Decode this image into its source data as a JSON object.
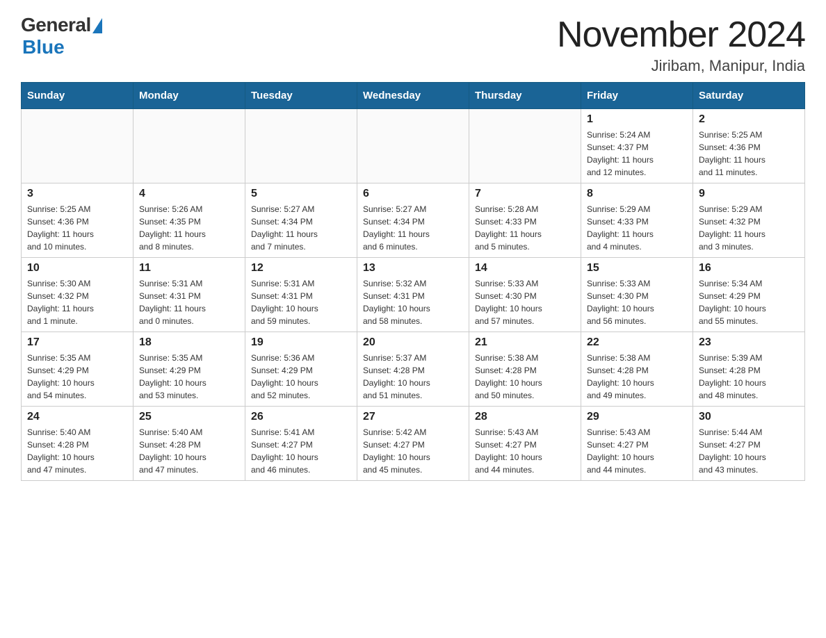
{
  "header": {
    "logo_general": "General",
    "logo_blue": "Blue",
    "month_title": "November 2024",
    "location": "Jiribam, Manipur, India"
  },
  "weekdays": [
    "Sunday",
    "Monday",
    "Tuesday",
    "Wednesday",
    "Thursday",
    "Friday",
    "Saturday"
  ],
  "weeks": [
    [
      {
        "day": "",
        "info": ""
      },
      {
        "day": "",
        "info": ""
      },
      {
        "day": "",
        "info": ""
      },
      {
        "day": "",
        "info": ""
      },
      {
        "day": "",
        "info": ""
      },
      {
        "day": "1",
        "info": "Sunrise: 5:24 AM\nSunset: 4:37 PM\nDaylight: 11 hours\nand 12 minutes."
      },
      {
        "day": "2",
        "info": "Sunrise: 5:25 AM\nSunset: 4:36 PM\nDaylight: 11 hours\nand 11 minutes."
      }
    ],
    [
      {
        "day": "3",
        "info": "Sunrise: 5:25 AM\nSunset: 4:36 PM\nDaylight: 11 hours\nand 10 minutes."
      },
      {
        "day": "4",
        "info": "Sunrise: 5:26 AM\nSunset: 4:35 PM\nDaylight: 11 hours\nand 8 minutes."
      },
      {
        "day": "5",
        "info": "Sunrise: 5:27 AM\nSunset: 4:34 PM\nDaylight: 11 hours\nand 7 minutes."
      },
      {
        "day": "6",
        "info": "Sunrise: 5:27 AM\nSunset: 4:34 PM\nDaylight: 11 hours\nand 6 minutes."
      },
      {
        "day": "7",
        "info": "Sunrise: 5:28 AM\nSunset: 4:33 PM\nDaylight: 11 hours\nand 5 minutes."
      },
      {
        "day": "8",
        "info": "Sunrise: 5:29 AM\nSunset: 4:33 PM\nDaylight: 11 hours\nand 4 minutes."
      },
      {
        "day": "9",
        "info": "Sunrise: 5:29 AM\nSunset: 4:32 PM\nDaylight: 11 hours\nand 3 minutes."
      }
    ],
    [
      {
        "day": "10",
        "info": "Sunrise: 5:30 AM\nSunset: 4:32 PM\nDaylight: 11 hours\nand 1 minute."
      },
      {
        "day": "11",
        "info": "Sunrise: 5:31 AM\nSunset: 4:31 PM\nDaylight: 11 hours\nand 0 minutes."
      },
      {
        "day": "12",
        "info": "Sunrise: 5:31 AM\nSunset: 4:31 PM\nDaylight: 10 hours\nand 59 minutes."
      },
      {
        "day": "13",
        "info": "Sunrise: 5:32 AM\nSunset: 4:31 PM\nDaylight: 10 hours\nand 58 minutes."
      },
      {
        "day": "14",
        "info": "Sunrise: 5:33 AM\nSunset: 4:30 PM\nDaylight: 10 hours\nand 57 minutes."
      },
      {
        "day": "15",
        "info": "Sunrise: 5:33 AM\nSunset: 4:30 PM\nDaylight: 10 hours\nand 56 minutes."
      },
      {
        "day": "16",
        "info": "Sunrise: 5:34 AM\nSunset: 4:29 PM\nDaylight: 10 hours\nand 55 minutes."
      }
    ],
    [
      {
        "day": "17",
        "info": "Sunrise: 5:35 AM\nSunset: 4:29 PM\nDaylight: 10 hours\nand 54 minutes."
      },
      {
        "day": "18",
        "info": "Sunrise: 5:35 AM\nSunset: 4:29 PM\nDaylight: 10 hours\nand 53 minutes."
      },
      {
        "day": "19",
        "info": "Sunrise: 5:36 AM\nSunset: 4:29 PM\nDaylight: 10 hours\nand 52 minutes."
      },
      {
        "day": "20",
        "info": "Sunrise: 5:37 AM\nSunset: 4:28 PM\nDaylight: 10 hours\nand 51 minutes."
      },
      {
        "day": "21",
        "info": "Sunrise: 5:38 AM\nSunset: 4:28 PM\nDaylight: 10 hours\nand 50 minutes."
      },
      {
        "day": "22",
        "info": "Sunrise: 5:38 AM\nSunset: 4:28 PM\nDaylight: 10 hours\nand 49 minutes."
      },
      {
        "day": "23",
        "info": "Sunrise: 5:39 AM\nSunset: 4:28 PM\nDaylight: 10 hours\nand 48 minutes."
      }
    ],
    [
      {
        "day": "24",
        "info": "Sunrise: 5:40 AM\nSunset: 4:28 PM\nDaylight: 10 hours\nand 47 minutes."
      },
      {
        "day": "25",
        "info": "Sunrise: 5:40 AM\nSunset: 4:28 PM\nDaylight: 10 hours\nand 47 minutes."
      },
      {
        "day": "26",
        "info": "Sunrise: 5:41 AM\nSunset: 4:27 PM\nDaylight: 10 hours\nand 46 minutes."
      },
      {
        "day": "27",
        "info": "Sunrise: 5:42 AM\nSunset: 4:27 PM\nDaylight: 10 hours\nand 45 minutes."
      },
      {
        "day": "28",
        "info": "Sunrise: 5:43 AM\nSunset: 4:27 PM\nDaylight: 10 hours\nand 44 minutes."
      },
      {
        "day": "29",
        "info": "Sunrise: 5:43 AM\nSunset: 4:27 PM\nDaylight: 10 hours\nand 44 minutes."
      },
      {
        "day": "30",
        "info": "Sunrise: 5:44 AM\nSunset: 4:27 PM\nDaylight: 10 hours\nand 43 minutes."
      }
    ]
  ]
}
